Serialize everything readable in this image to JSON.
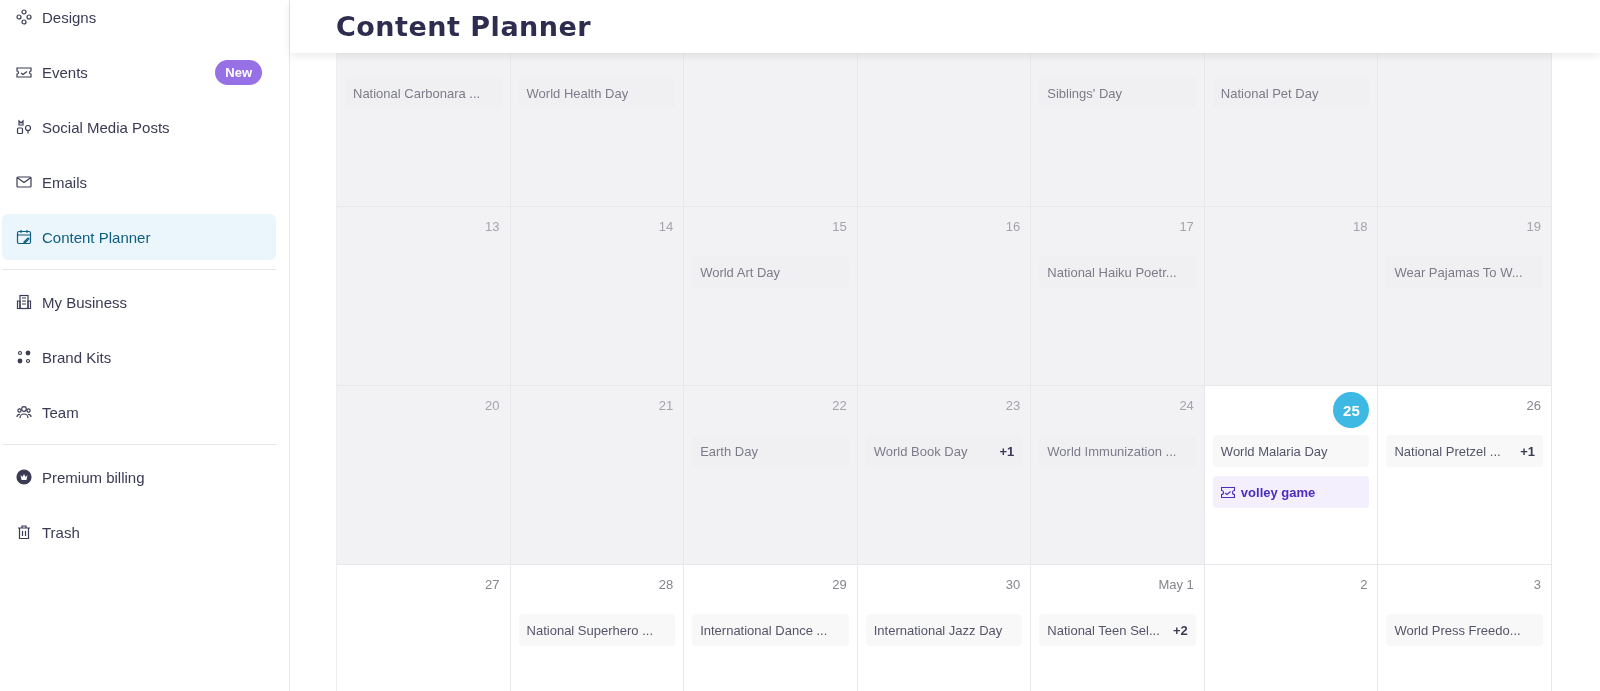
{
  "sidebar": {
    "groups": [
      {
        "items": [
          {
            "label": "Designs",
            "selected": false
          },
          {
            "label": "Events",
            "selected": false,
            "badge": "New"
          },
          {
            "label": "Social Media Posts",
            "selected": false
          },
          {
            "label": "Emails",
            "selected": false
          },
          {
            "label": "Content Planner",
            "selected": true
          }
        ]
      },
      {
        "items": [
          {
            "label": "My Business",
            "selected": false
          },
          {
            "label": "Brand Kits",
            "selected": false
          },
          {
            "label": "Team",
            "selected": false
          }
        ]
      },
      {
        "items": [
          {
            "label": "Premium billing",
            "selected": false
          },
          {
            "label": "Trash",
            "selected": false
          }
        ]
      }
    ]
  },
  "header": {
    "title": "Content Planner"
  },
  "calendar": {
    "weeks": [
      {
        "days": [
          {
            "past": true,
            "events": [
              {
                "kind": "observance",
                "title": "National Carbonara ..."
              }
            ]
          },
          {
            "past": true,
            "events": [
              {
                "kind": "observance",
                "title": "World Health Day"
              }
            ]
          },
          {
            "past": true
          },
          {
            "past": true
          },
          {
            "past": true,
            "events": [
              {
                "kind": "observance",
                "title": "Siblings' Day"
              }
            ]
          },
          {
            "past": true,
            "events": [
              {
                "kind": "observance",
                "title": "National Pet Day"
              }
            ]
          },
          {
            "past": true
          }
        ]
      },
      {
        "days": [
          {
            "date": "13",
            "past": true,
            "today": false
          },
          {
            "date": "14",
            "past": true,
            "today": false
          },
          {
            "date": "15",
            "past": true,
            "today": false,
            "events": [
              {
                "kind": "observance",
                "title": "World Art Day"
              }
            ]
          },
          {
            "date": "16",
            "past": true,
            "today": false
          },
          {
            "date": "17",
            "past": true,
            "today": false,
            "events": [
              {
                "kind": "observance",
                "title": "National Haiku Poetr..."
              }
            ]
          },
          {
            "date": "18",
            "past": true,
            "today": false
          },
          {
            "date": "19",
            "past": true,
            "today": false,
            "events": [
              {
                "kind": "observance",
                "title": "Wear Pajamas To W..."
              }
            ]
          }
        ]
      },
      {
        "days": [
          {
            "date": "20",
            "past": true,
            "today": false
          },
          {
            "date": "21",
            "past": true,
            "today": false
          },
          {
            "date": "22",
            "past": true,
            "today": false,
            "events": [
              {
                "kind": "observance",
                "title": "Earth Day"
              }
            ]
          },
          {
            "date": "23",
            "past": true,
            "today": false,
            "events": [
              {
                "kind": "observance",
                "title": "World Book Day",
                "more": "+1"
              }
            ]
          },
          {
            "date": "24",
            "past": true,
            "today": false,
            "events": [
              {
                "kind": "observance",
                "title": "World Immunization ..."
              }
            ]
          },
          {
            "date": "25",
            "past": false,
            "today": true,
            "events": [
              {
                "kind": "observance",
                "title": "World Malaria Day"
              },
              {
                "kind": "event",
                "title": "volley game"
              }
            ]
          },
          {
            "date": "26",
            "past": false,
            "today": false,
            "events": [
              {
                "kind": "observance",
                "title": "National Pretzel ...",
                "more": "+1"
              }
            ]
          }
        ]
      },
      {
        "days": [
          {
            "date": "27",
            "past": false,
            "today": false
          },
          {
            "date": "28",
            "past": false,
            "today": false,
            "events": [
              {
                "kind": "observance",
                "title": "National Superhero ..."
              }
            ]
          },
          {
            "date": "29",
            "past": false,
            "today": false,
            "events": [
              {
                "kind": "observance",
                "title": "International Dance ..."
              }
            ]
          },
          {
            "date": "30",
            "past": false,
            "today": false,
            "events": [
              {
                "kind": "observance",
                "title": "International Jazz Day"
              }
            ]
          },
          {
            "date": "May 1",
            "past": false,
            "today": false,
            "events": [
              {
                "kind": "observance",
                "title": "National Teen Sel...",
                "more": "+2"
              }
            ]
          },
          {
            "date": "2",
            "past": false,
            "today": false
          },
          {
            "date": "3",
            "past": false,
            "today": false,
            "events": [
              {
                "kind": "observance",
                "title": "World Press Freedo..."
              }
            ]
          }
        ]
      }
    ]
  }
}
